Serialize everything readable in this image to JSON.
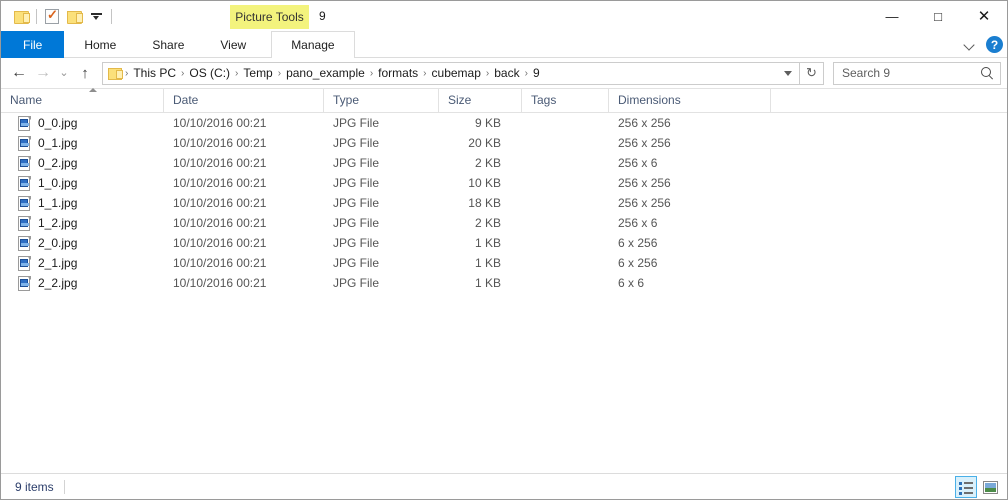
{
  "window": {
    "title": "9",
    "contextual_tab_label": "Picture Tools",
    "controls": {
      "minimize": "—",
      "maximize": "□",
      "close": "✕"
    }
  },
  "quick_access": {
    "items": [
      {
        "name": "folder-icon",
        "tooltip": "Explorer"
      },
      {
        "name": "properties-icon",
        "tooltip": "Properties"
      },
      {
        "name": "new-folder-icon",
        "tooltip": "New folder"
      },
      {
        "name": "customize-dropdown-icon",
        "tooltip": "Customize Quick Access Toolbar"
      }
    ]
  },
  "ribbon": {
    "tabs": [
      {
        "label": "File",
        "active": true
      },
      {
        "label": "Home",
        "active": false
      },
      {
        "label": "Share",
        "active": false
      },
      {
        "label": "View",
        "active": false
      }
    ],
    "contextual_tab": {
      "label": "Manage"
    },
    "collapse_icon": "chevron-down-icon",
    "help_icon": "?"
  },
  "address_bar": {
    "back": "←",
    "forward": "→",
    "recent": "⌄",
    "up": "↑",
    "breadcrumbs": [
      "This PC",
      "OS (C:)",
      "Temp",
      "pano_example",
      "formats",
      "cubemap",
      "back",
      "9"
    ],
    "separator": "›",
    "refresh": "↻"
  },
  "search": {
    "placeholder": "Search 9",
    "value": ""
  },
  "columns": [
    {
      "label": "Name",
      "width": 163,
      "align": "left"
    },
    {
      "label": "Date",
      "width": 160,
      "align": "left"
    },
    {
      "label": "Type",
      "width": 115,
      "align": "left"
    },
    {
      "label": "Size",
      "width": 83,
      "align": "right"
    },
    {
      "label": "Tags",
      "width": 87,
      "align": "left"
    },
    {
      "label": "Dimensions",
      "width": 162,
      "align": "left"
    }
  ],
  "sort": {
    "column": "Name",
    "direction": "ascending"
  },
  "files": [
    {
      "name": "0_0.jpg",
      "date": "10/10/2016 00:21",
      "type": "JPG File",
      "size": "9 KB",
      "tags": "",
      "dimensions": "256 x 256"
    },
    {
      "name": "0_1.jpg",
      "date": "10/10/2016 00:21",
      "type": "JPG File",
      "size": "20 KB",
      "tags": "",
      "dimensions": "256 x 256"
    },
    {
      "name": "0_2.jpg",
      "date": "10/10/2016 00:21",
      "type": "JPG File",
      "size": "2 KB",
      "tags": "",
      "dimensions": "256 x 6"
    },
    {
      "name": "1_0.jpg",
      "date": "10/10/2016 00:21",
      "type": "JPG File",
      "size": "10 KB",
      "tags": "",
      "dimensions": "256 x 256"
    },
    {
      "name": "1_1.jpg",
      "date": "10/10/2016 00:21",
      "type": "JPG File",
      "size": "18 KB",
      "tags": "",
      "dimensions": "256 x 256"
    },
    {
      "name": "1_2.jpg",
      "date": "10/10/2016 00:21",
      "type": "JPG File",
      "size": "2 KB",
      "tags": "",
      "dimensions": "256 x 6"
    },
    {
      "name": "2_0.jpg",
      "date": "10/10/2016 00:21",
      "type": "JPG File",
      "size": "1 KB",
      "tags": "",
      "dimensions": "6 x 256"
    },
    {
      "name": "2_1.jpg",
      "date": "10/10/2016 00:21",
      "type": "JPG File",
      "size": "1 KB",
      "tags": "",
      "dimensions": "6 x 256"
    },
    {
      "name": "2_2.jpg",
      "date": "10/10/2016 00:21",
      "type": "JPG File",
      "size": "1 KB",
      "tags": "",
      "dimensions": "6 x 6"
    }
  ],
  "status_bar": {
    "item_count": "9 items",
    "view_buttons": [
      {
        "name": "details-view-button",
        "active": true
      },
      {
        "name": "large-icons-view-button",
        "active": false
      }
    ]
  },
  "colors": {
    "accent": "#0078d7",
    "contextual_tab": "#f3f37d",
    "header_text": "#4a5a75",
    "row_text": "#555555",
    "status_text": "#2c3e6b"
  }
}
